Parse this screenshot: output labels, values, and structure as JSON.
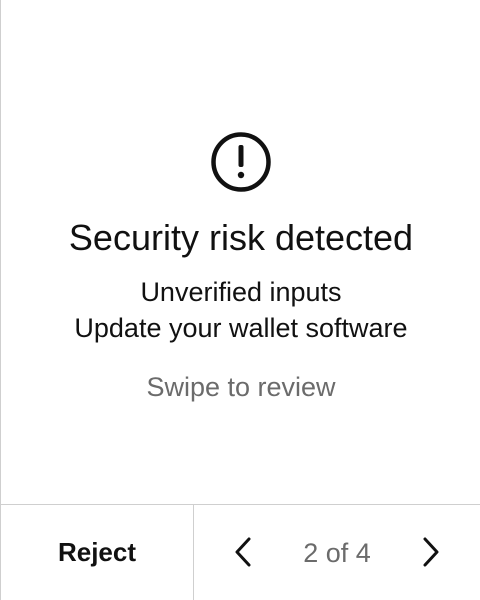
{
  "alert": {
    "icon": "exclamation-circle-icon",
    "title": "Security risk detected",
    "messages": [
      "Unverified inputs",
      "Update your wallet software"
    ],
    "hint": "Swipe to review"
  },
  "footer": {
    "reject_label": "Reject",
    "prev_icon": "chevron-left-icon",
    "next_icon": "chevron-right-icon",
    "page_indicator": "2 of 4"
  },
  "colors": {
    "text": "#111111",
    "muted": "#6b6b6b",
    "divider": "#cfcfcf"
  }
}
